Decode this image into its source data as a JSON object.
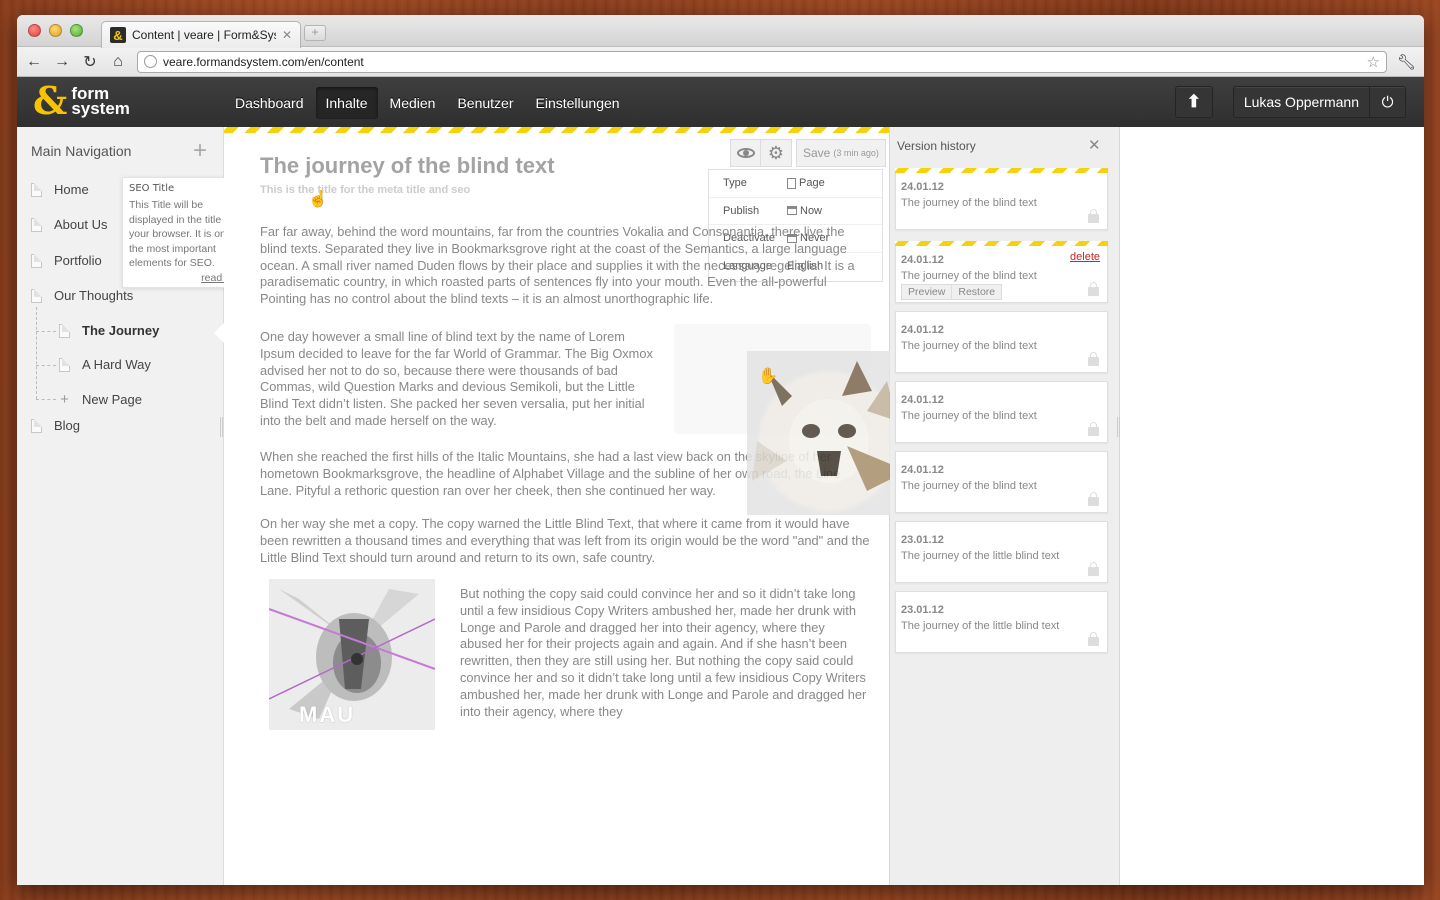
{
  "browser": {
    "tab_title": "Content | veare | Form&System",
    "tab_favicon": "&",
    "url": "veare.formandsystem.com/en/content"
  },
  "app": {
    "logo_amp": "&",
    "logo_line1": "form",
    "logo_line2": "system",
    "brand_color": "#f6c500",
    "menu": [
      "Dashboard",
      "Inhalte",
      "Medien",
      "Benutzer",
      "Einstellungen"
    ],
    "active_menu": "Inhalte",
    "user_name": "Lukas Oppermann"
  },
  "sidebar": {
    "title": "Main Navigation",
    "items": [
      {
        "label": "Home"
      },
      {
        "label": "About Us"
      },
      {
        "label": "Portfolio"
      },
      {
        "label": "Our Thoughts"
      },
      {
        "label": "The Journey"
      },
      {
        "label": "A Hard Way"
      },
      {
        "label": "New Page"
      },
      {
        "label": "Blog"
      }
    ],
    "seo_tip": {
      "title": "SEO Title",
      "text": "This Title will be displayed in the title of your browser. It is on of the most important elements for SEO.",
      "more": "read more"
    }
  },
  "editor": {
    "title": "The journey of the blind text",
    "meta_placeholder": "This is the title for the meta title and seo",
    "save_label": "Save",
    "save_time": "(3 min ago)",
    "props": [
      {
        "key": "Type",
        "value": "Page"
      },
      {
        "key": "Publish",
        "value": "Now"
      },
      {
        "key": "Deactivate",
        "value": "Never"
      },
      {
        "key": "Language",
        "value": "English"
      }
    ],
    "paragraphs": [
      "Far far away, behind the word mountains, far from the countries Vokalia and Consonantia, there live the blind texts. Separated they live in Bookmarksgrove right at the coast of the Semantics, a large language ocean. A small river named Duden flows by their place and supplies it with the necessary regelialia. It is a paradisematic country, in which roasted parts of sentences fly into your mouth. Even the all-powerful Pointing has no control about the blind texts – it is an almost unorthographic life.",
      "One day however a small line of blind text by the name of Lorem Ipsum decided to leave for the far World of Grammar. The Big Oxmox advised her not to do so, because there were thousands of bad Commas, wild Question Marks and devious Semikoli, but the Little Blind Text didn’t listen. She packed her seven versalia, put her initial into the belt and made herself on the way.",
      "When she reached the first hills of the Italic Mountains, she had a last view back on the skyline of her hometown Bookmarksgrove, the headline of Alphabet Village and the subline of her own road, the Line Lane. Pityful a rethoric question ran over her cheek, then she continued her way.",
      "On her way she met a copy. The copy warned the Little Blind Text, that where it came from it would have been rewritten a thousand times and everything that was left from its origin would be the word \"and\" and the Little Blind Text should turn around and return to its own, safe country.",
      "But nothing the copy said could convince her and so it didn’t take long until a few insidious Copy Writers ambushed her, made her drunk with Longe and Parole and dragged her into their agency, where they abused her for their projects again and again. And if she hasn’t been rewritten, then they are still using her. But nothing the copy said could convince her and so it didn’t take long until a few insidious Copy Writers ambushed her, made her drunk with Longe and Parole and dragged her into their agency, where they"
    ],
    "image_caption": "MAU"
  },
  "history": {
    "title": "Version history",
    "delete_label": "delete",
    "preview_label": "Preview",
    "restore_label": "Restore",
    "versions": [
      {
        "date": "24.01.12",
        "title": "The journey of the blind text"
      },
      {
        "date": "24.01.12",
        "title": "The journey of the blind text"
      },
      {
        "date": "24.01.12",
        "title": "The journey of the blind text"
      },
      {
        "date": "24.01.12",
        "title": "The journey of the blind text"
      },
      {
        "date": "24.01.12",
        "title": "The journey of the blind text"
      },
      {
        "date": "23.01.12",
        "title": "The journey of the little blind text"
      },
      {
        "date": "23.01.12",
        "title": "The journey of the little blind text"
      }
    ]
  },
  "colors": {
    "accent_stripe": "#f4d20c",
    "delete": "#cc2222",
    "header": "#333333"
  }
}
